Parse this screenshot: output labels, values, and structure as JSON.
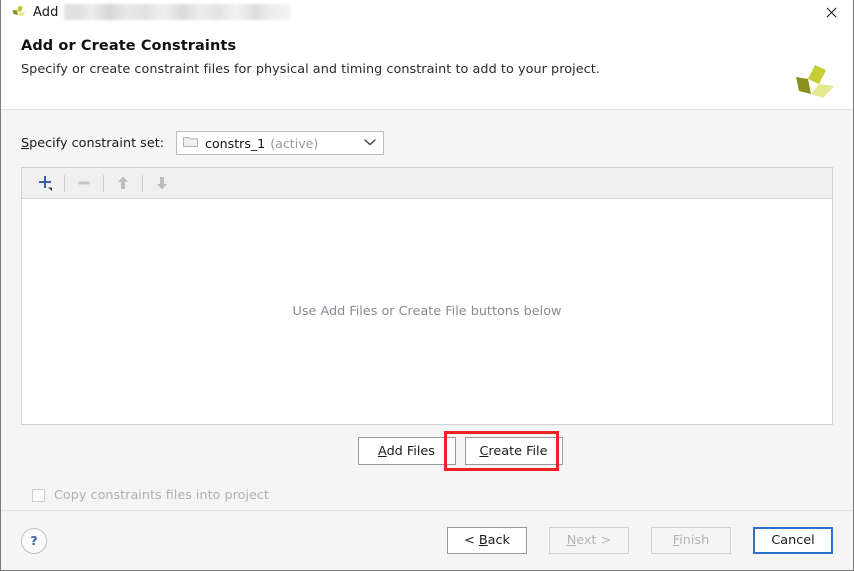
{
  "titlebar": {
    "icon": "xilinx-logo-icon",
    "title": "Add",
    "redacted": true,
    "close_label": "✕"
  },
  "header": {
    "title": "Add or Create Constraints",
    "subtitle": "Specify or create constraint files for physical and timing constraint to add to your project.",
    "logo": "xilinx-pinwheel-logo"
  },
  "constraint_set": {
    "label": "Specify constraint set:",
    "folder_icon": "folder-icon",
    "value": "constrs_1",
    "suffix": "(active)",
    "dropdown_icon": "chevron-down-icon",
    "options": [
      "constrs_1 (active)"
    ]
  },
  "toolbar": {
    "add_label": "+",
    "add_name": "plus-icon",
    "remove_label": "−",
    "remove_name": "minus-icon",
    "move_up_name": "arrow-up-icon",
    "move_down_name": "arrow-down-icon"
  },
  "file_list": {
    "empty_text": "Use Add Files or Create File buttons below",
    "items": []
  },
  "actions": {
    "add_files_label": "Add Files",
    "add_files_mnemonic": "A",
    "create_file_label": "Create File",
    "create_file_mnemonic": "C",
    "highlight_color": "#ee2222",
    "highlighted_button": "create-file-button"
  },
  "copy_option": {
    "label": "Copy constraints files into project",
    "checked": false,
    "enabled": false
  },
  "footer": {
    "help_label": "?",
    "buttons": [
      {
        "id": "back",
        "label": "< Back",
        "enabled": true,
        "focused": false
      },
      {
        "id": "next",
        "label": "Next >",
        "enabled": false,
        "focused": false
      },
      {
        "id": "finish",
        "label": "Finish",
        "enabled": false,
        "focused": false
      },
      {
        "id": "cancel",
        "label": "Cancel",
        "enabled": true,
        "focused": true
      }
    ]
  },
  "colors": {
    "dialog_bg": "#f5f5f5",
    "panel_bg": "#ffffff",
    "accent_blue": "#3a5f9e",
    "focus_blue": "#2d6fcb",
    "highlight_red": "#ee2222",
    "logo_green": "#b9c42e",
    "logo_dark_green": "#8a8f1e",
    "logo_light_green": "#e3e98a"
  }
}
